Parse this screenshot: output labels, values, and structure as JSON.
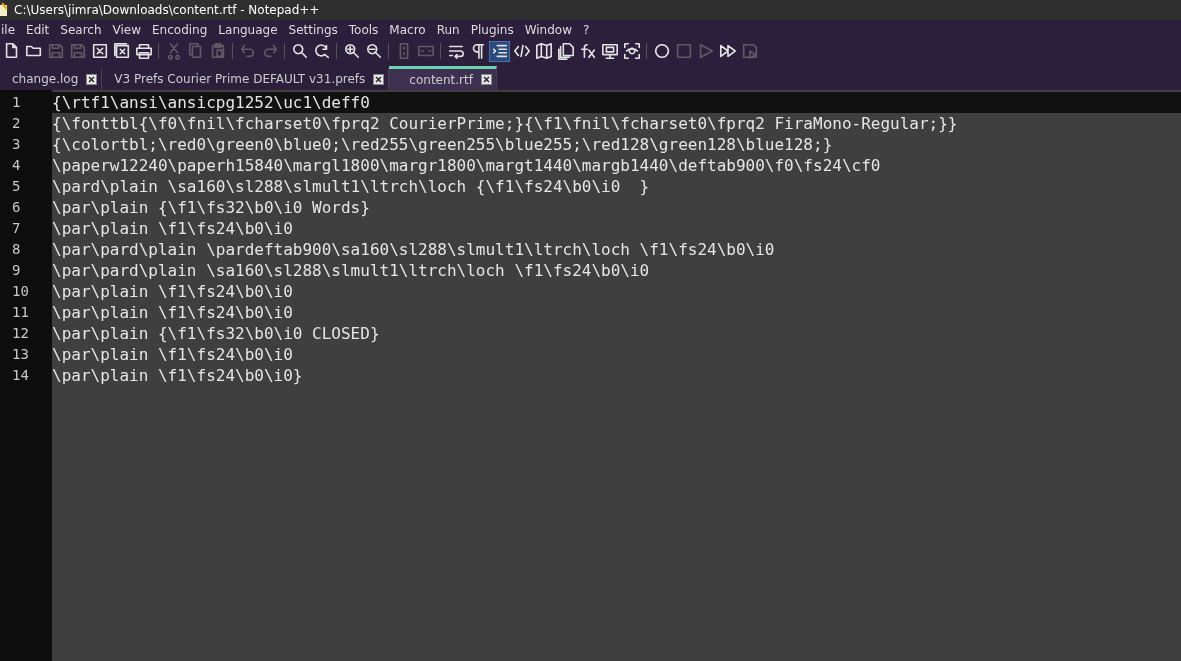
{
  "window": {
    "title": "C:\\Users\\jimra\\Downloads\\content.rtf - Notepad++"
  },
  "menu": [
    "ile",
    "Edit",
    "Search",
    "View",
    "Encoding",
    "Language",
    "Settings",
    "Tools",
    "Macro",
    "Run",
    "Plugins",
    "Window",
    "?"
  ],
  "toolbar": [
    {
      "kind": "new",
      "disabled": false,
      "on": false
    },
    {
      "kind": "open",
      "disabled": false,
      "on": false
    },
    {
      "kind": "save",
      "disabled": true,
      "on": false
    },
    {
      "kind": "save",
      "disabled": true,
      "on": false
    },
    {
      "kind": "close",
      "disabled": false,
      "on": false
    },
    {
      "kind": "closeall",
      "disabled": false,
      "on": false
    },
    {
      "kind": "print",
      "disabled": false,
      "on": false
    },
    {
      "kind": "sep"
    },
    {
      "kind": "cut",
      "disabled": true,
      "on": false
    },
    {
      "kind": "copy",
      "disabled": true,
      "on": false
    },
    {
      "kind": "paste",
      "disabled": true,
      "on": false
    },
    {
      "kind": "sep"
    },
    {
      "kind": "undo",
      "disabled": true,
      "on": false
    },
    {
      "kind": "redo",
      "disabled": true,
      "on": false
    },
    {
      "kind": "sep"
    },
    {
      "kind": "find",
      "disabled": false,
      "on": false
    },
    {
      "kind": "replace",
      "disabled": false,
      "on": false
    },
    {
      "kind": "sep"
    },
    {
      "kind": "zoomin",
      "disabled": false,
      "on": false
    },
    {
      "kind": "zoomout",
      "disabled": false,
      "on": false
    },
    {
      "kind": "sep"
    },
    {
      "kind": "syncv",
      "disabled": true,
      "on": false
    },
    {
      "kind": "synch",
      "disabled": true,
      "on": false
    },
    {
      "kind": "sep"
    },
    {
      "kind": "wrap",
      "disabled": false,
      "on": false
    },
    {
      "kind": "pilcrow",
      "disabled": false,
      "on": false
    },
    {
      "kind": "indent",
      "disabled": false,
      "on": true
    },
    {
      "kind": "tag",
      "disabled": false,
      "on": false
    },
    {
      "kind": "map",
      "disabled": false,
      "on": false
    },
    {
      "kind": "docs",
      "disabled": false,
      "on": false
    },
    {
      "kind": "function",
      "disabled": false,
      "on": false
    },
    {
      "kind": "monitor",
      "disabled": false,
      "on": false
    },
    {
      "kind": "focus",
      "disabled": false,
      "on": false
    },
    {
      "kind": "sep"
    },
    {
      "kind": "record",
      "disabled": false,
      "on": false
    },
    {
      "kind": "stop",
      "disabled": true,
      "on": false
    },
    {
      "kind": "play",
      "disabled": true,
      "on": false
    },
    {
      "kind": "playmulti",
      "disabled": false,
      "on": false
    },
    {
      "kind": "savemacro",
      "disabled": true,
      "on": false
    }
  ],
  "tabs": [
    {
      "label": "change.log",
      "selected": false
    },
    {
      "label": "V3 Prefs Courier Prime DEFAULT v31.prefs",
      "selected": false
    },
    {
      "label": "content.rtf",
      "selected": true
    }
  ],
  "editor": {
    "lines": [
      {
        "number": "1",
        "text": "{\\rtf1\\ansi\\ansicpg1252\\uc1\\deff0",
        "current": true
      },
      {
        "number": "2",
        "text": "{\\fonttbl{\\f0\\fnil\\fcharset0\\fprq2 CourierPrime;}{\\f1\\fnil\\fcharset0\\fprq2 FiraMono-Regular;}}",
        "current": false
      },
      {
        "number": "3",
        "text": "{\\colortbl;\\red0\\green0\\blue0;\\red255\\green255\\blue255;\\red128\\green128\\blue128;}",
        "current": false
      },
      {
        "number": "4",
        "text": "\\paperw12240\\paperh15840\\margl1800\\margr1800\\margt1440\\margb1440\\deftab900\\f0\\fs24\\cf0",
        "current": false
      },
      {
        "number": "5",
        "text": "\\pard\\plain \\sa160\\sl288\\slmult1\\ltrch\\loch {\\f1\\fs24\\b0\\i0  }",
        "current": false
      },
      {
        "number": "6",
        "text": "\\par\\plain {\\f1\\fs32\\b0\\i0 Words}",
        "current": false
      },
      {
        "number": "7",
        "text": "\\par\\plain \\f1\\fs24\\b0\\i0",
        "current": false
      },
      {
        "number": "8",
        "text": "\\par\\pard\\plain \\pardeftab900\\sa160\\sl288\\slmult1\\ltrch\\loch \\f1\\fs24\\b0\\i0",
        "current": false
      },
      {
        "number": "9",
        "text": "\\par\\pard\\plain \\sa160\\sl288\\slmult1\\ltrch\\loch \\f1\\fs24\\b0\\i0",
        "current": false
      },
      {
        "number": "10",
        "text": "\\par\\plain \\f1\\fs24\\b0\\i0",
        "current": false
      },
      {
        "number": "11",
        "text": "\\par\\plain \\f1\\fs24\\b0\\i0",
        "current": false
      },
      {
        "number": "12",
        "text": "\\par\\plain {\\f1\\fs32\\b0\\i0 CLOSED}",
        "current": false
      },
      {
        "number": "13",
        "text": "\\par\\plain \\f1\\fs24\\b0\\i0",
        "current": false
      },
      {
        "number": "14",
        "text": "\\par\\plain \\f1\\fs24\\b0\\i0}",
        "current": false
      }
    ]
  }
}
